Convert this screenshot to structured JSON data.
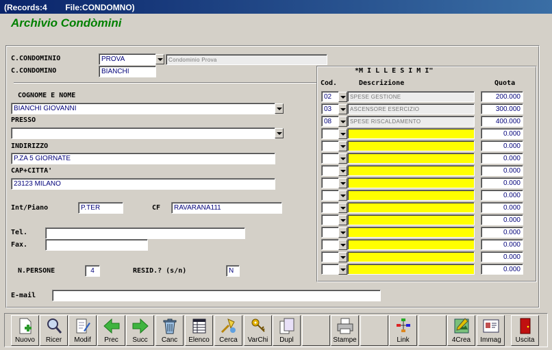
{
  "window": {
    "title": "(Records:4        File:CONDOMNO)"
  },
  "app": {
    "title": "Archivio Condòmini"
  },
  "form": {
    "cod_condominio_label": "C.CONDOMINIO",
    "cod_condominio_value": "PROVA",
    "cod_condominio_desc": "Condominio Prova",
    "condomino_label": "C.CONDOMINO",
    "condomino_value": "BIANCHI",
    "cognome_label": "COGNOME E NOME",
    "cognome_value": "BIANCHI GIOVANNI",
    "presso_label": "PRESSO",
    "presso_value": "",
    "indirizzo_label": "INDIRIZZO",
    "indirizzo_value": "P.ZA 5 GIORNATE",
    "cap_label": "CAP+CITTA'",
    "cap_value": "23123 MILANO",
    "int_label": "Int/Piano",
    "int_value": "P.TER",
    "cf_label": "CF",
    "cf_value": "RAVARANA111",
    "tel_label": "Tel.",
    "tel_value": "",
    "fax_label": "Fax.",
    "fax_value": "",
    "npersone_label": "N.PERSONE",
    "npersone_value": "4",
    "resid_label": "RESID.? (s/n)",
    "resid_value": "N",
    "email_label": "E-mail",
    "email_value": ""
  },
  "millesimi": {
    "title": "*M I L L E S I M I\"",
    "col_cod": "Cod.",
    "col_desc": "Descrizione",
    "col_quota": "Quota",
    "rows": [
      {
        "cod": "02",
        "desc": "SPESE GESTIONE",
        "quota": "200.000"
      },
      {
        "cod": "03",
        "desc": "ASCENSORE ESERCIZIO",
        "quota": "300.000"
      },
      {
        "cod": "08",
        "desc": "SPESE RISCALDAMENTO",
        "quota": "400.000"
      },
      {
        "cod": "",
        "desc": "",
        "quota": "0.000"
      },
      {
        "cod": "",
        "desc": "",
        "quota": "0.000"
      },
      {
        "cod": "",
        "desc": "",
        "quota": "0.000"
      },
      {
        "cod": "",
        "desc": "",
        "quota": "0.000"
      },
      {
        "cod": "",
        "desc": "",
        "quota": "0.000"
      },
      {
        "cod": "",
        "desc": "",
        "quota": "0.000"
      },
      {
        "cod": "",
        "desc": "",
        "quota": "0.000"
      },
      {
        "cod": "",
        "desc": "",
        "quota": "0.000"
      },
      {
        "cod": "",
        "desc": "",
        "quota": "0.000"
      },
      {
        "cod": "",
        "desc": "",
        "quota": "0.000"
      },
      {
        "cod": "",
        "desc": "",
        "quota": "0.000"
      },
      {
        "cod": "",
        "desc": "",
        "quota": "0.000"
      }
    ]
  },
  "toolbar": {
    "buttons": [
      {
        "label": "Nuovo",
        "icon": "new-document-icon"
      },
      {
        "label": "Ricer",
        "icon": "search-icon"
      },
      {
        "label": "Modif",
        "icon": "edit-icon"
      },
      {
        "label": "Prec",
        "icon": "arrow-left-icon"
      },
      {
        "label": "Succ",
        "icon": "arrow-right-icon"
      },
      {
        "label": "Canc",
        "icon": "trash-icon"
      },
      {
        "label": "Elenco",
        "icon": "list-icon"
      },
      {
        "label": "Cerca",
        "icon": "find-icon"
      },
      {
        "label": "VarChi",
        "icon": "keys-icon"
      },
      {
        "label": "Dupl",
        "icon": "duplicate-icon"
      },
      {
        "label": "",
        "icon": ""
      },
      {
        "label": "Stampe",
        "icon": "printer-icon"
      },
      {
        "label": "",
        "icon": ""
      },
      {
        "label": "Link",
        "icon": "link-icon"
      },
      {
        "label": "",
        "icon": ""
      },
      {
        "label": "4Crea",
        "icon": "create-icon"
      },
      {
        "label": "Immag",
        "icon": "image-card-icon"
      },
      {
        "label": "Uscita",
        "icon": "exit-door-icon"
      }
    ]
  }
}
